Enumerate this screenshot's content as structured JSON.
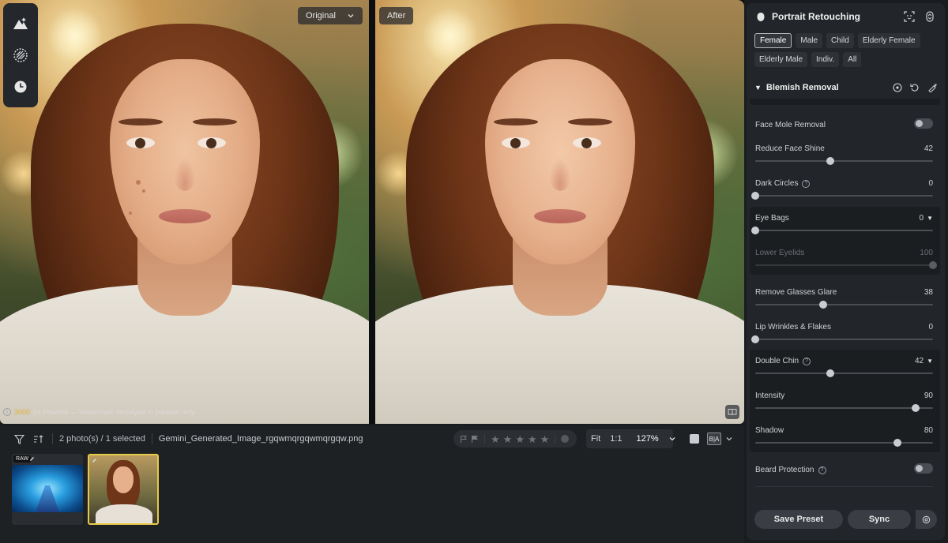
{
  "viewer": {
    "original_label": "Original",
    "after_label": "After",
    "watermark_size": "3000",
    "watermark_text": "px Preview — Watermark displayed in preview only."
  },
  "filmstrip": {
    "selection_text": "2 photo(s) / 1 selected",
    "filename": "Gemini_Generated_Image_rgqwmqrgqwmqrgqw.png",
    "zoom_fit": "Fit",
    "zoom_1to1": "1:1",
    "zoom_level": "127%",
    "thumb1_badge": "RAW",
    "ba_label": "B|A"
  },
  "panel": {
    "title": "Portrait Retouching",
    "chips": [
      "Female",
      "Male",
      "Child",
      "Elderly Female",
      "Elderly Male",
      "Indiv.",
      "All"
    ],
    "active_chip": "Female",
    "section_title": "Blemish Removal",
    "rows": {
      "face_mole_removal": {
        "label": "Face Mole Removal"
      },
      "reduce_face_shine": {
        "label": "Reduce Face Shine",
        "value": "42",
        "level": 0.42
      },
      "dark_circles": {
        "label": "Dark Circles",
        "value": "0",
        "level": 0
      },
      "eye_bags": {
        "label": "Eye Bags",
        "value": "0",
        "level": 0
      },
      "lower_eyelids": {
        "label": "Lower Eyelids",
        "value": "100",
        "level": 1
      },
      "remove_glasses_glare": {
        "label": "Remove Glasses Glare",
        "value": "38",
        "level": 0.38
      },
      "lip_wrinkles": {
        "label": "Lip Wrinkles & Flakes",
        "value": "0",
        "level": 0
      },
      "double_chin": {
        "label": "Double Chin",
        "value": "42",
        "level": 0.42
      },
      "intensity": {
        "label": "Intensity",
        "value": "90",
        "level": 0.9
      },
      "shadow": {
        "label": "Shadow",
        "value": "80",
        "level": 0.8
      },
      "beard_protection": {
        "label": "Beard Protection"
      }
    },
    "save_preset": "Save Preset",
    "sync": "Sync"
  },
  "colors": {
    "accent_selected": "#e7c94a",
    "panel_bg": "#22252a"
  }
}
